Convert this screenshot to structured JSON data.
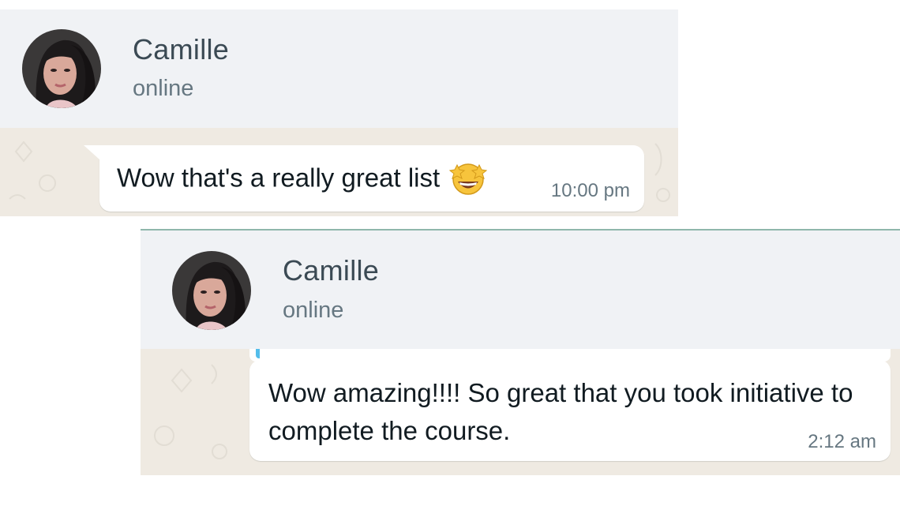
{
  "chats": [
    {
      "contact": {
        "name": "Camille",
        "status": "online"
      },
      "message": {
        "text": "Wow that's a really great list",
        "emoji": "star-struck-emoji",
        "time": "10:00 pm"
      }
    },
    {
      "contact": {
        "name": "Camille",
        "status": "online"
      },
      "message": {
        "text": "Wow amazing!!!! So great that you took initiative to complete the course.",
        "time": "2:12 am"
      }
    }
  ],
  "colors": {
    "header_bg": "#f0f2f5",
    "chat_bg": "#efeae2",
    "bubble_bg": "#ffffff",
    "name_text": "#3b4a54",
    "secondary_text": "#667781",
    "quote_accent": "#53bdeb"
  }
}
